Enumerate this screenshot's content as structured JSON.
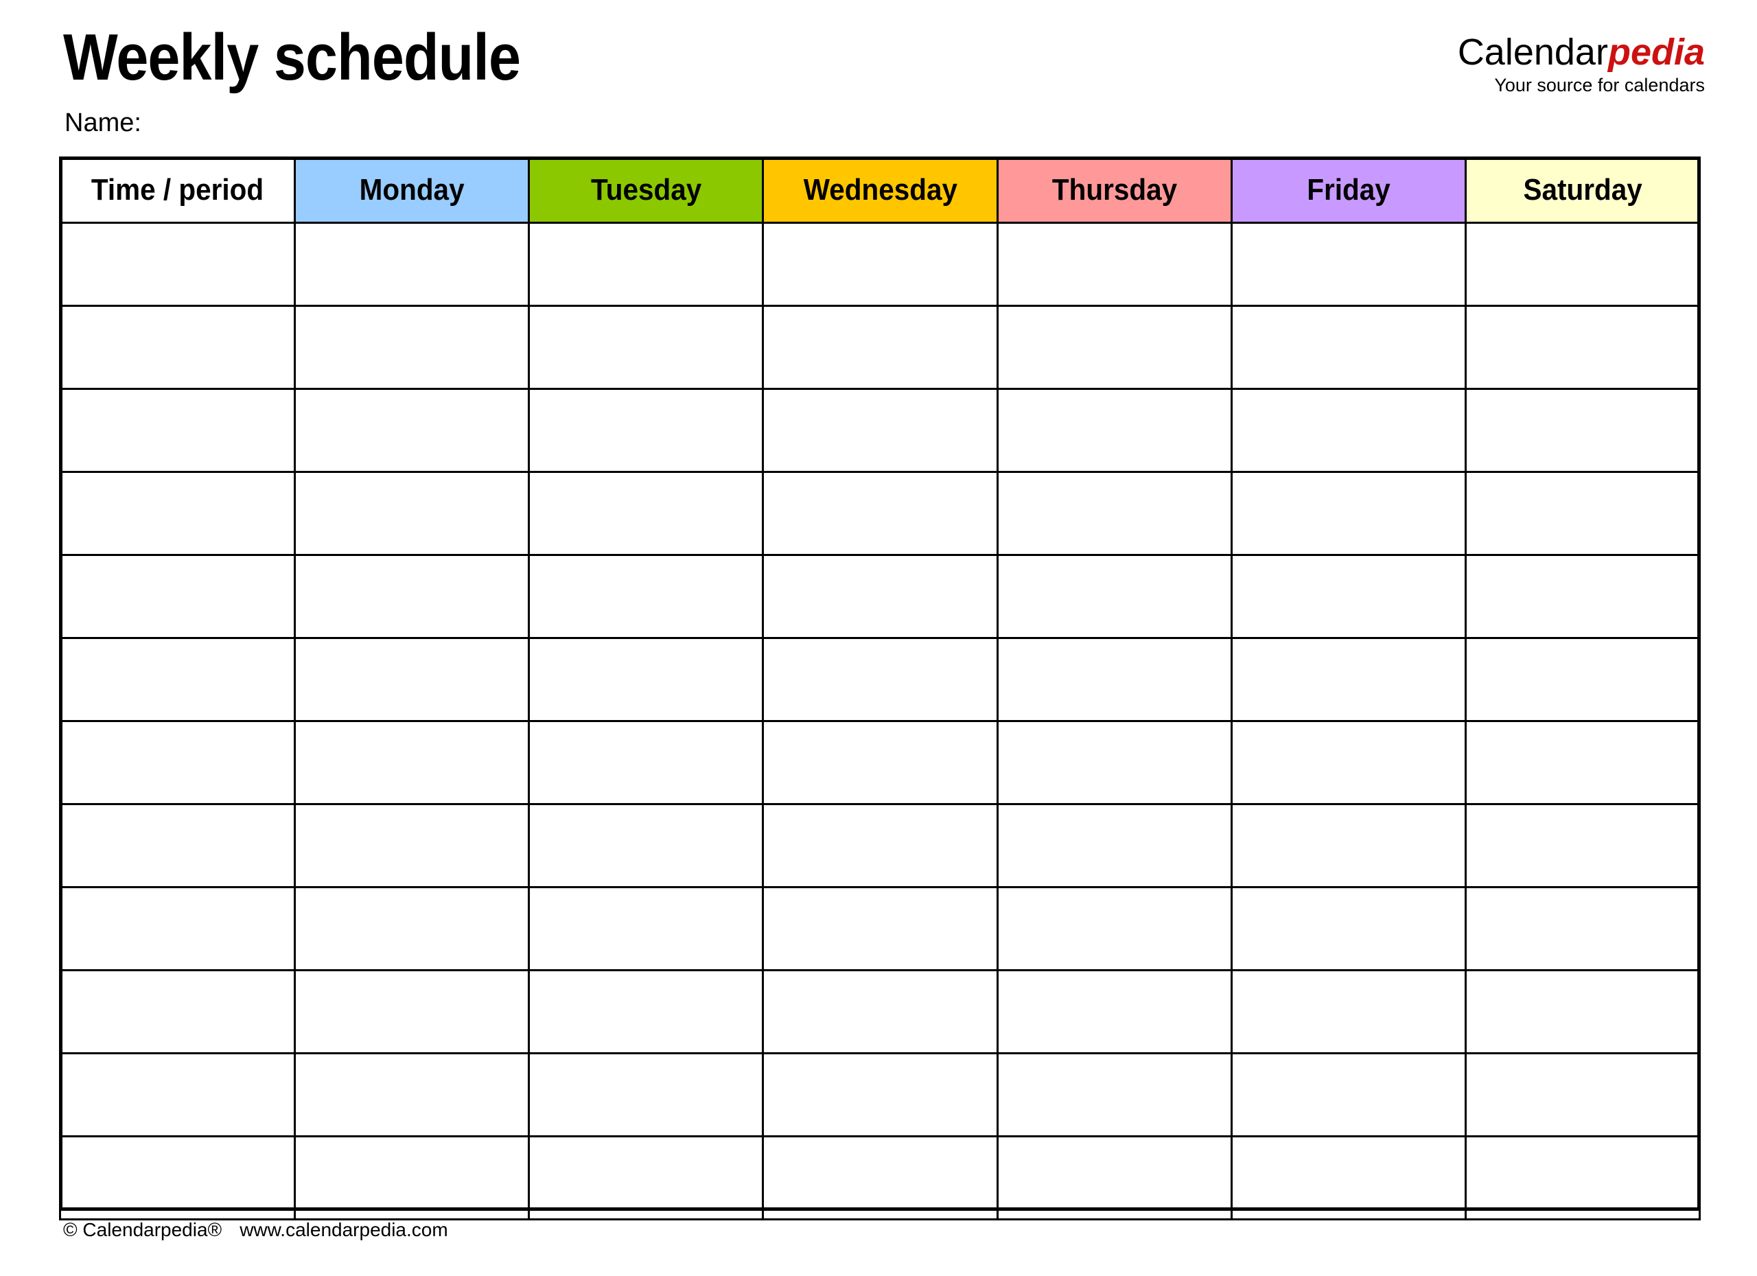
{
  "document": {
    "title": "Weekly schedule",
    "name_label": "Name:"
  },
  "brand": {
    "word_part_1": "Calendar",
    "word_part_2": "pedia",
    "tagline": "Your source for calendars",
    "accent_color": "#cc1111"
  },
  "table": {
    "columns": [
      {
        "label": "Time / period",
        "color": "#ffffff"
      },
      {
        "label": "Monday",
        "color": "#99ccff"
      },
      {
        "label": "Tuesday",
        "color": "#8cc800"
      },
      {
        "label": "Wednesday",
        "color": "#ffc600"
      },
      {
        "label": "Thursday",
        "color": "#ff9999"
      },
      {
        "label": "Friday",
        "color": "#c899ff"
      },
      {
        "label": "Saturday",
        "color": "#ffffcc"
      }
    ],
    "row_count": 12,
    "rows": [
      [
        "",
        "",
        "",
        "",
        "",
        "",
        ""
      ],
      [
        "",
        "",
        "",
        "",
        "",
        "",
        ""
      ],
      [
        "",
        "",
        "",
        "",
        "",
        "",
        ""
      ],
      [
        "",
        "",
        "",
        "",
        "",
        "",
        ""
      ],
      [
        "",
        "",
        "",
        "",
        "",
        "",
        ""
      ],
      [
        "",
        "",
        "",
        "",
        "",
        "",
        ""
      ],
      [
        "",
        "",
        "",
        "",
        "",
        "",
        ""
      ],
      [
        "",
        "",
        "",
        "",
        "",
        "",
        ""
      ],
      [
        "",
        "",
        "",
        "",
        "",
        "",
        ""
      ],
      [
        "",
        "",
        "",
        "",
        "",
        "",
        ""
      ],
      [
        "",
        "",
        "",
        "",
        "",
        "",
        ""
      ],
      [
        "",
        "",
        "",
        "",
        "",
        "",
        ""
      ]
    ]
  },
  "footer": {
    "copyright": "© Calendarpedia®",
    "website": "www.calendarpedia.com"
  }
}
